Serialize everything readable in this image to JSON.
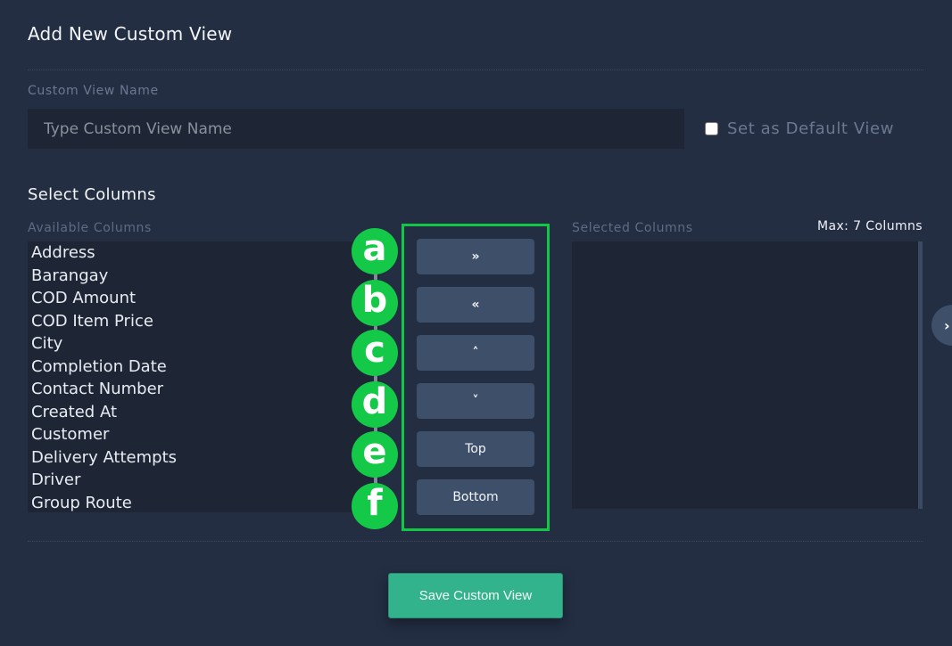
{
  "header": {
    "title": "Add New Custom View"
  },
  "form": {
    "name_label": "Custom View Name",
    "name_value": "",
    "name_placeholder": "Type Custom View Name",
    "default_checkbox_label": "Set as Default View",
    "default_checked": false
  },
  "columns": {
    "section_title": "Select Columns",
    "available_label": "Available Columns",
    "selected_label": "Selected Columns",
    "max_label": "Max: 7 Columns",
    "available": [
      "Address",
      "Barangay",
      "COD Amount",
      "COD Item Price",
      "City",
      "Completion Date",
      "Contact Number",
      "Created At",
      "Customer",
      "Delivery Attempts",
      "Driver",
      "Group Route"
    ],
    "selected": []
  },
  "buttons": {
    "move_right": {
      "label": "»",
      "icon": "double-chevron-right-icon"
    },
    "move_left": {
      "label": "«",
      "icon": "double-chevron-left-icon"
    },
    "move_up": {
      "label": "˄",
      "icon": "chevron-up-icon"
    },
    "move_down": {
      "label": "˅",
      "icon": "chevron-down-icon"
    },
    "move_top": {
      "label": "Top"
    },
    "move_bottom": {
      "label": "Bottom"
    },
    "save": {
      "label": "Save Custom View"
    },
    "side_toggle": {
      "label": "›",
      "icon": "chevron-right-icon"
    }
  },
  "annotations": {
    "color": "#13c947",
    "badges": [
      "a",
      "b",
      "c",
      "d",
      "e",
      "f"
    ]
  }
}
